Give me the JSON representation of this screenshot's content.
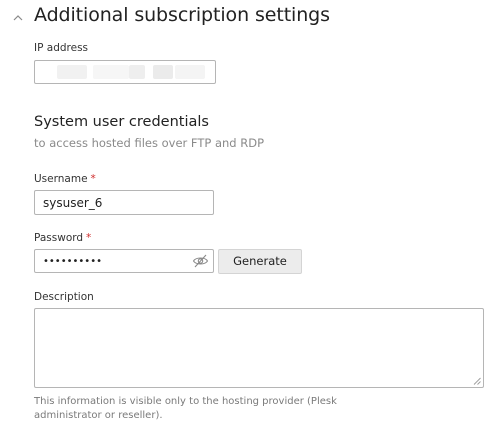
{
  "section": {
    "title": "Additional subscription settings",
    "chevron_icon": "chevron-up-icon"
  },
  "ip_address": {
    "label": "IP address",
    "value": ""
  },
  "credentials": {
    "title": "System user credentials",
    "hint": "to access hosted files over FTP and RDP"
  },
  "username": {
    "label": "Username",
    "required_mark": "*",
    "value": "sysuser_6"
  },
  "password": {
    "label": "Password",
    "required_mark": "*",
    "value": "••••••••••",
    "toggle_icon": "eye-slash-icon",
    "generate_label": "Generate"
  },
  "description": {
    "label": "Description",
    "value": "",
    "hint": "This information is visible only to the hosting provider (Plesk administrator or reseller)."
  },
  "colors": {
    "required": "#d02d2d",
    "border": "#b5b5b5",
    "button_bg": "#ececec",
    "hint_text": "#8a8a8a"
  }
}
